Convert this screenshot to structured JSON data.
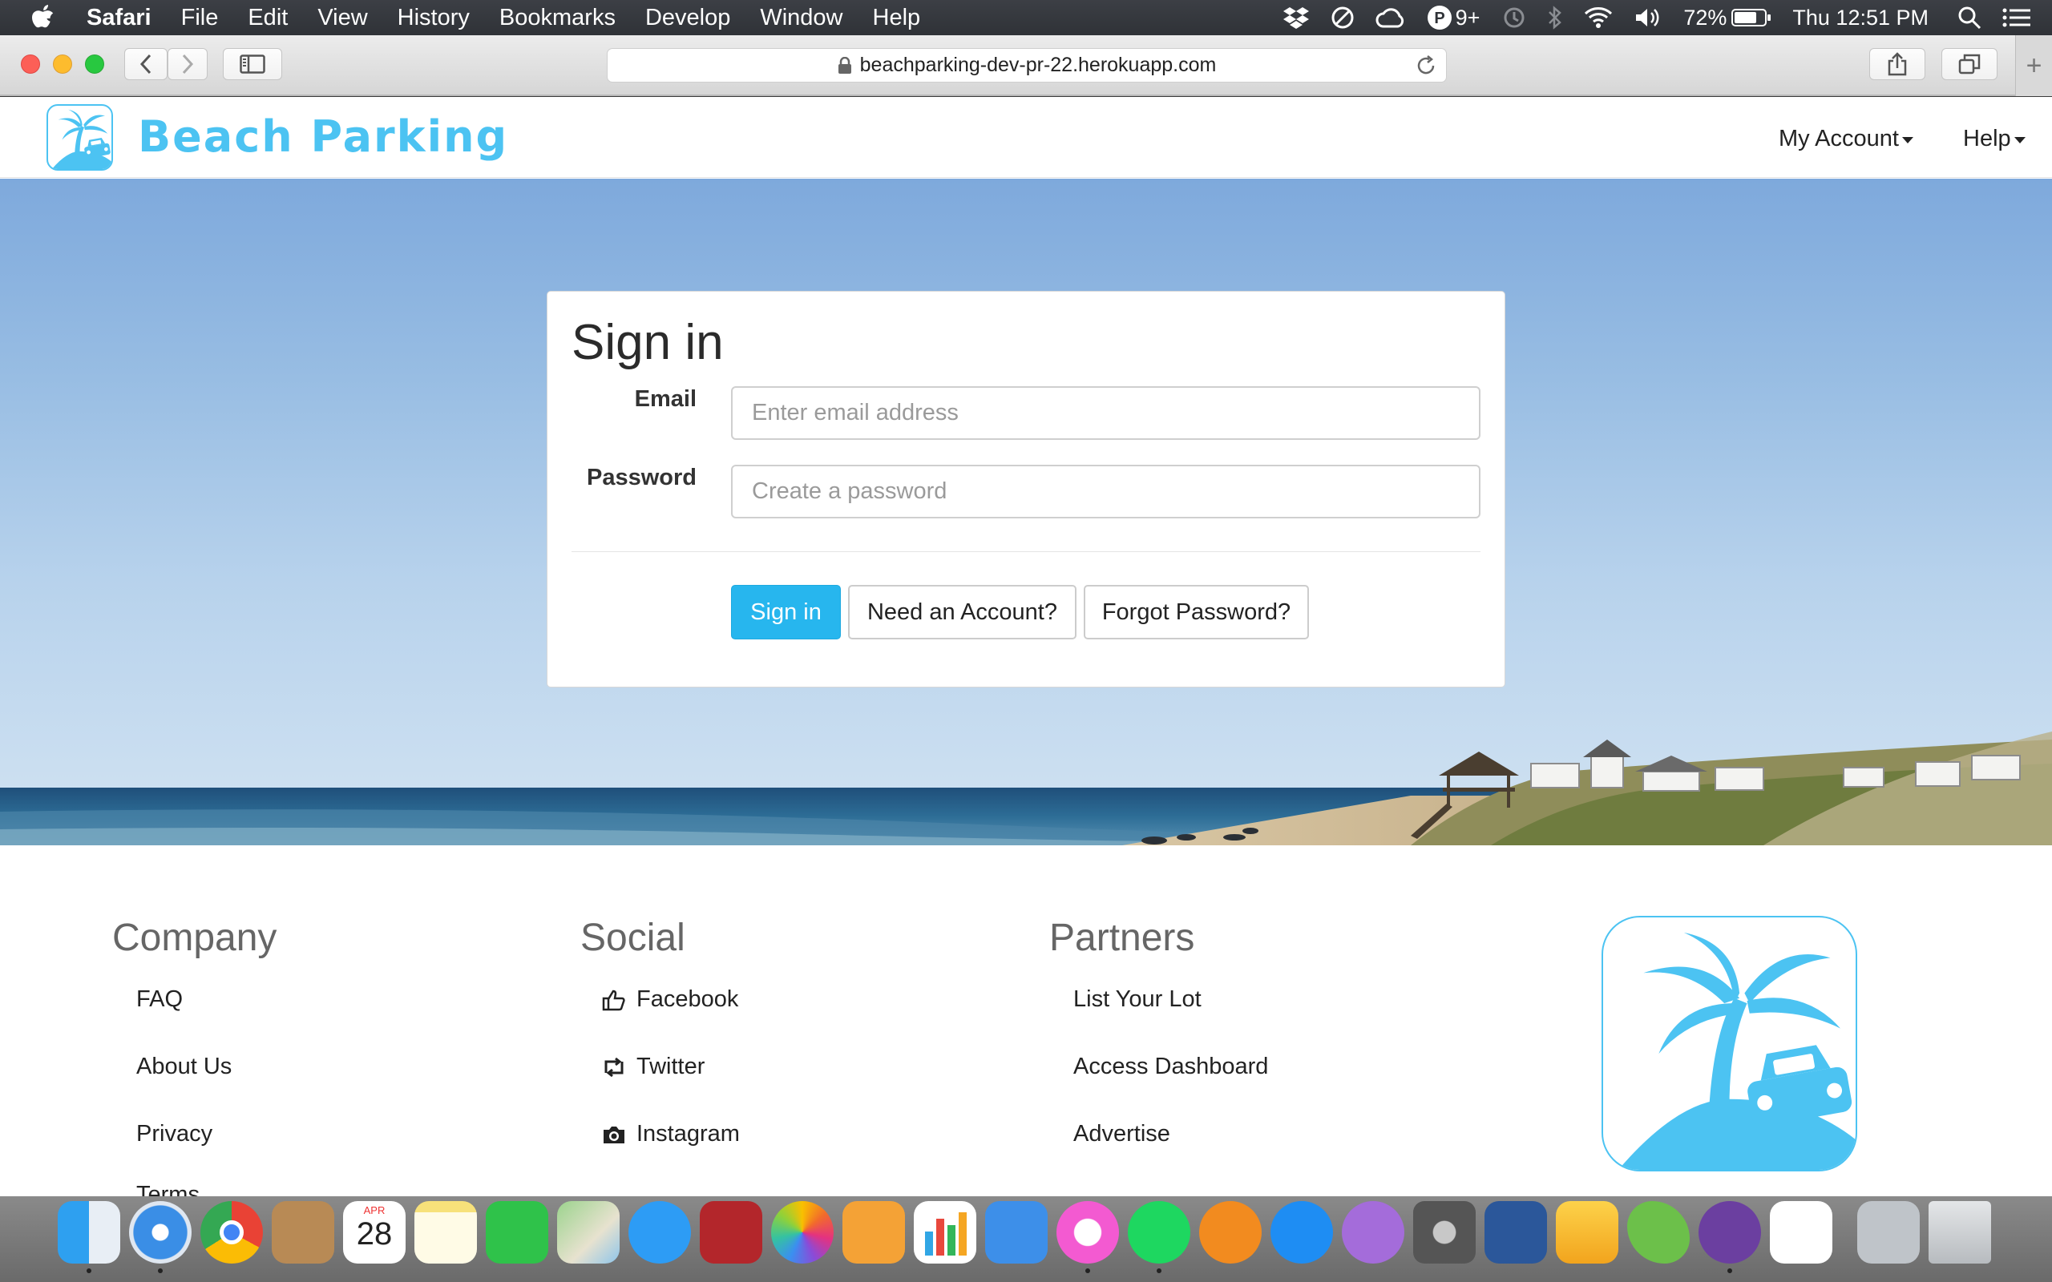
{
  "menubar": {
    "app_name": "Safari",
    "items": [
      "File",
      "Edit",
      "View",
      "History",
      "Bookmarks",
      "Develop",
      "Window",
      "Help"
    ],
    "status": {
      "notifications_badge": "9+",
      "battery": "72%",
      "clock": "Thu 12:51 PM"
    },
    "icons": [
      "apple-icon",
      "dropbox-icon",
      "sync-icon",
      "creative-cloud-icon",
      "p-badge-icon",
      "time-machine-icon",
      "bluetooth-icon",
      "wifi-icon",
      "volume-icon",
      "battery-icon",
      "spotlight-icon",
      "notification-center-icon"
    ]
  },
  "browser": {
    "url": "beachparking-dev-pr-22.herokuapp.com",
    "icons": [
      "back-icon",
      "forward-icon",
      "sidebar-icon",
      "lock-icon",
      "reload-icon",
      "share-icon",
      "tabs-icon",
      "new-tab-icon"
    ]
  },
  "site": {
    "brand": "Beach Parking",
    "nav": {
      "account": "My Account",
      "help": "Help"
    },
    "signin": {
      "title": "Sign in",
      "email_label": "Email",
      "email_placeholder": "Enter email address",
      "password_label": "Password",
      "password_placeholder": "Create a password",
      "submit": "Sign in",
      "need_account": "Need an Account?",
      "forgot": "Forgot Password?"
    },
    "footer": {
      "company": {
        "heading": "Company",
        "links": [
          "FAQ",
          "About Us",
          "Privacy",
          "Terms"
        ]
      },
      "social": {
        "heading": "Social",
        "links": [
          "Facebook",
          "Twitter",
          "Instagram"
        ],
        "icons": [
          "thumbs-up-icon",
          "retweet-icon",
          "camera-icon"
        ]
      },
      "partners": {
        "heading": "Partners",
        "links": [
          "List Your Lot",
          "Access Dashboard",
          "Advertise"
        ]
      }
    },
    "colors": {
      "brand": "#4cc3f2",
      "primary_button": "#27b6ee"
    }
  },
  "dock": {
    "calendar_month": "APR",
    "calendar_day": "28",
    "apps": [
      "finder",
      "safari",
      "chrome",
      "contacts",
      "calendar",
      "notes",
      "facetime",
      "maps",
      "messages",
      "photo-booth",
      "photos",
      "pages",
      "numbers",
      "keynote",
      "itunes",
      "spotify",
      "ibooks",
      "app-store",
      "feedback",
      "system-preferences",
      "word",
      "sketch",
      "leaf",
      "github",
      "slack",
      "finder-window",
      "trash"
    ]
  }
}
